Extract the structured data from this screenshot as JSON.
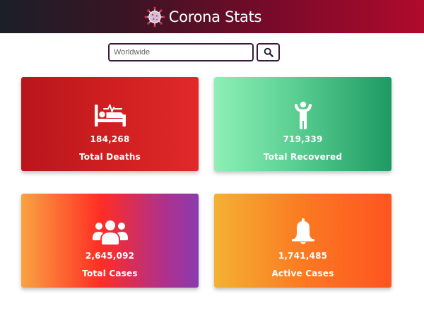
{
  "header": {
    "title": "Corona Stats",
    "logo_icon": "virus-icon",
    "colors": {
      "gradient_start": "#1b1f28",
      "gradient_end": "#b00a2c"
    }
  },
  "search": {
    "placeholder": "Worldwide",
    "value": "",
    "button_icon": "search-icon"
  },
  "stats": {
    "deaths": {
      "value": "184,268",
      "label": "Total Deaths",
      "icon": "hospital-bed-icon",
      "color": "#cf1f20"
    },
    "recovered": {
      "value": "719,339",
      "label": "Total Recovered",
      "icon": "person-arms-up-icon",
      "color": "#3fb97e"
    },
    "cases": {
      "value": "2,645,092",
      "label": "Total Cases",
      "icon": "users-group-icon",
      "color": "#ff2d24"
    },
    "active": {
      "value": "1,741,485",
      "label": "Active Cases",
      "icon": "bell-icon",
      "color": "#fb7a22"
    }
  }
}
